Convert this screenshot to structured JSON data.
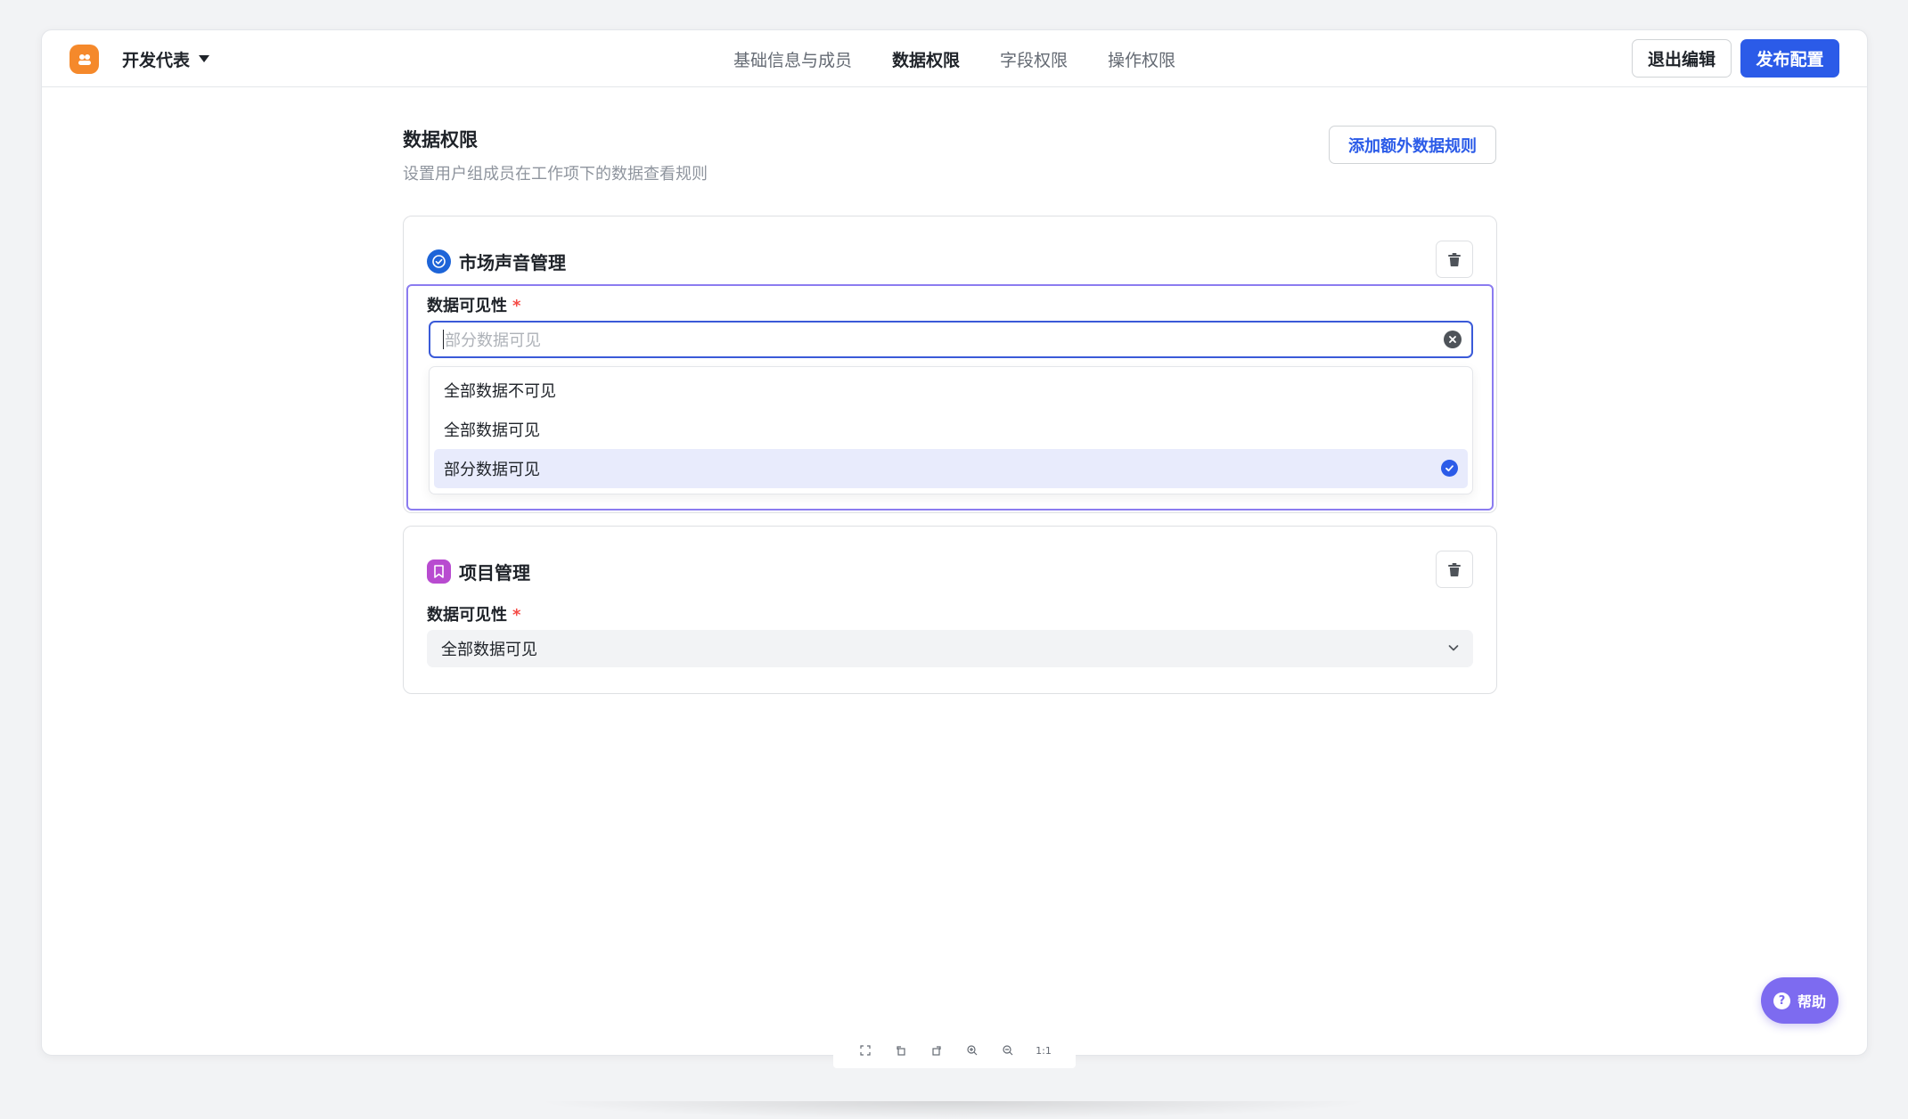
{
  "header": {
    "app_name": "开发代表",
    "tabs": [
      {
        "label": "基础信息与成员",
        "active": false
      },
      {
        "label": "数据权限",
        "active": true
      },
      {
        "label": "字段权限",
        "active": false
      },
      {
        "label": "操作权限",
        "active": false
      }
    ],
    "exit_label": "退出编辑",
    "publish_label": "发布配置"
  },
  "section": {
    "title": "数据权限",
    "description": "设置用户组成员在工作项下的数据查看规则",
    "add_rule_label": "添加额外数据规则"
  },
  "cards": [
    {
      "title": "市场声音管理",
      "field_label": "数据可见性",
      "required_mark": "*",
      "placeholder": "部分数据可见",
      "options": [
        "全部数据不可见",
        "全部数据可见",
        "部分数据可见"
      ],
      "selected_option": "部分数据可见"
    },
    {
      "title": "项目管理",
      "field_label": "数据可见性",
      "required_mark": "*",
      "value": "全部数据可见"
    }
  ],
  "help_label": "帮助",
  "viewer_toolbar": {
    "one_to_one_label": "1:1"
  },
  "colors": {
    "primary": "#2b5be8",
    "brand_orange": "#f5892b",
    "help_purple": "#7d6bf0",
    "focus_border": "#8b7cf0"
  }
}
